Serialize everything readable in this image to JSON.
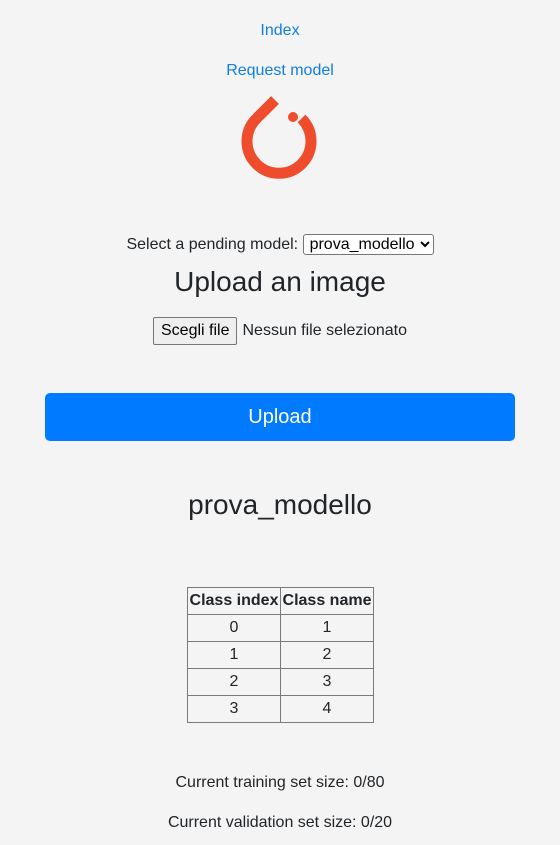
{
  "nav": {
    "index_label": "Index",
    "request_label": "Request model"
  },
  "logo": {
    "icon": "pytorch-logo-icon",
    "color": "#ee4c2c"
  },
  "model_select": {
    "label": "Select a pending model:",
    "selected": "prova_modello"
  },
  "upload": {
    "heading": "Upload an image",
    "choose_file_label": "Scegli file",
    "file_status": "Nessun file selezionato",
    "button_label": "Upload",
    "button_color": "#007bff"
  },
  "model": {
    "title": "prova_modello",
    "table": {
      "headers": [
        "Class index",
        "Class name"
      ],
      "rows": [
        [
          "0",
          "1"
        ],
        [
          "1",
          "2"
        ],
        [
          "2",
          "3"
        ],
        [
          "3",
          "4"
        ]
      ]
    },
    "training_set": "Current training set size: 0/80",
    "validation_set": "Current validation set size: 0/20"
  }
}
